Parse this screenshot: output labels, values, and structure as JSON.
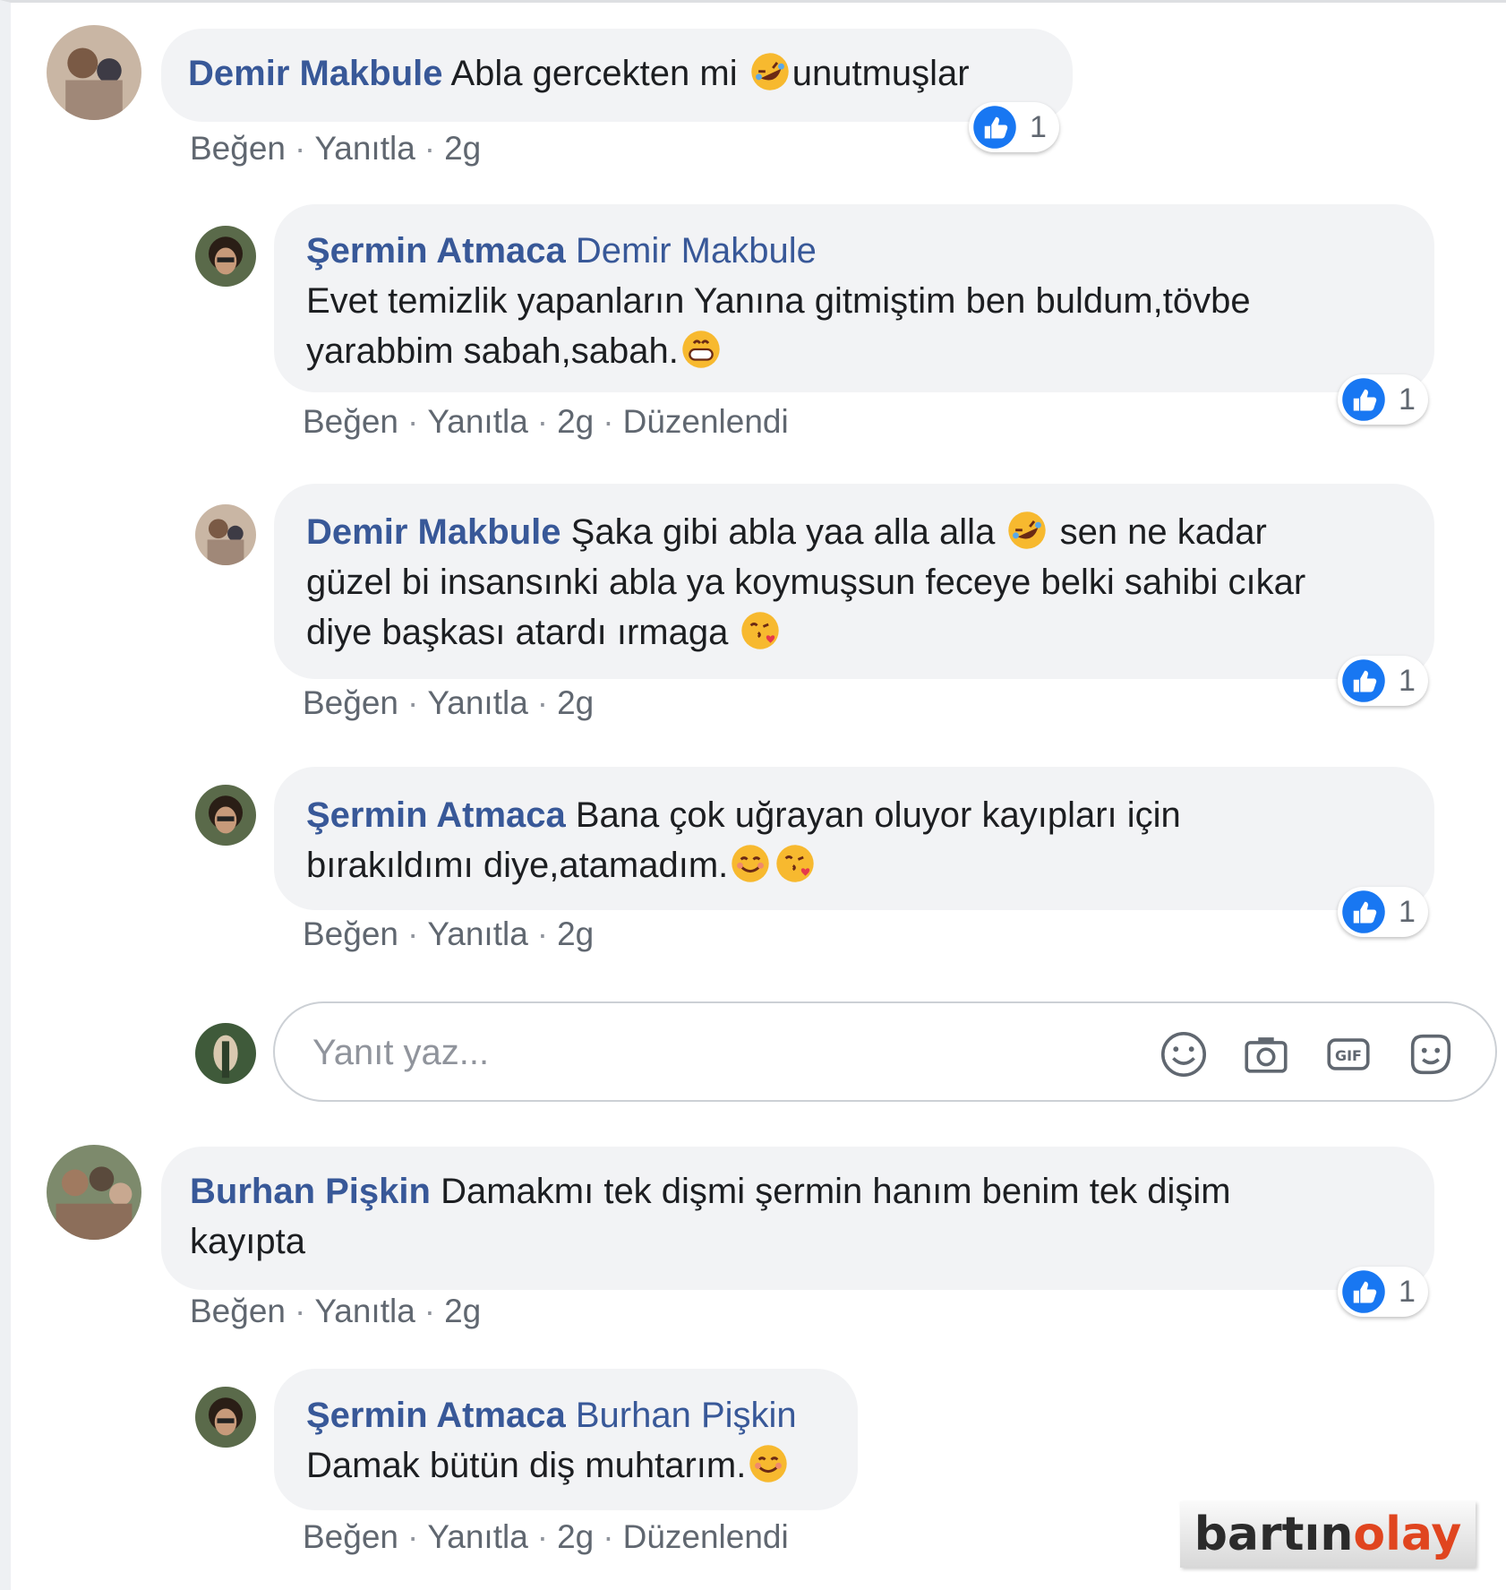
{
  "comments": [
    {
      "author": "Demir Makbule",
      "text": "Abla gercekten mi",
      "text_after_emoji": "unutmuşlar",
      "like": "Beğen",
      "reply": "Yanıtla",
      "time": "2g",
      "reaction_count": "1"
    },
    {
      "author": "Şermin Atmaca",
      "mention": "Demir Makbule",
      "line1": "Evet temizlik yapanların Yanına gitmiştim ben buldum,tövbe",
      "line2": "yarabbim sabah,sabah.",
      "like": "Beğen",
      "reply": "Yanıtla",
      "time": "2g",
      "edited": "Düzenlendi",
      "reaction_count": "1"
    },
    {
      "author": "Demir Makbule",
      "line1": "Şaka gibi abla yaa alla alla",
      "line1b": "sen ne kadar",
      "line2": "güzel bi insansınki abla ya koymuşsun feceye belki sahibi cıkar",
      "line3": "diye başkası atardı ırmaga",
      "like": "Beğen",
      "reply": "Yanıtla",
      "time": "2g",
      "reaction_count": "1"
    },
    {
      "author": "Şermin Atmaca",
      "line1": "Bana çok uğrayan oluyor kayıpları için",
      "line2": "bırakıldımı diye,atamadım.",
      "like": "Beğen",
      "reply": "Yanıtla",
      "time": "2g",
      "reaction_count": "1"
    },
    {
      "author": "Burhan Pişkin",
      "line1": "Damakmı tek dişmi şermin hanım benim tek dişim",
      "line2": "kayıpta",
      "like": "Beğen",
      "reply": "Yanıtla",
      "time": "2g",
      "reaction_count": "1"
    },
    {
      "author": "Şermin Atmaca",
      "mention": "Burhan Pişkin",
      "line2": "Damak bütün diş muhtarım.",
      "like": "Beğen",
      "reply": "Yanıtla",
      "time": "2g",
      "edited": "Düzenlendi"
    }
  ],
  "reply_box": {
    "placeholder": "Yanıt yaz...",
    "icons": [
      "emoji-icon",
      "camera-icon",
      "gif-icon",
      "sticker-icon"
    ]
  },
  "watermark": {
    "part1": "bartın",
    "part2": "olay"
  },
  "colors": {
    "author": "#385898",
    "bubble": "#f2f3f5",
    "like_blue": "#1877f2",
    "meta": "#606770"
  }
}
